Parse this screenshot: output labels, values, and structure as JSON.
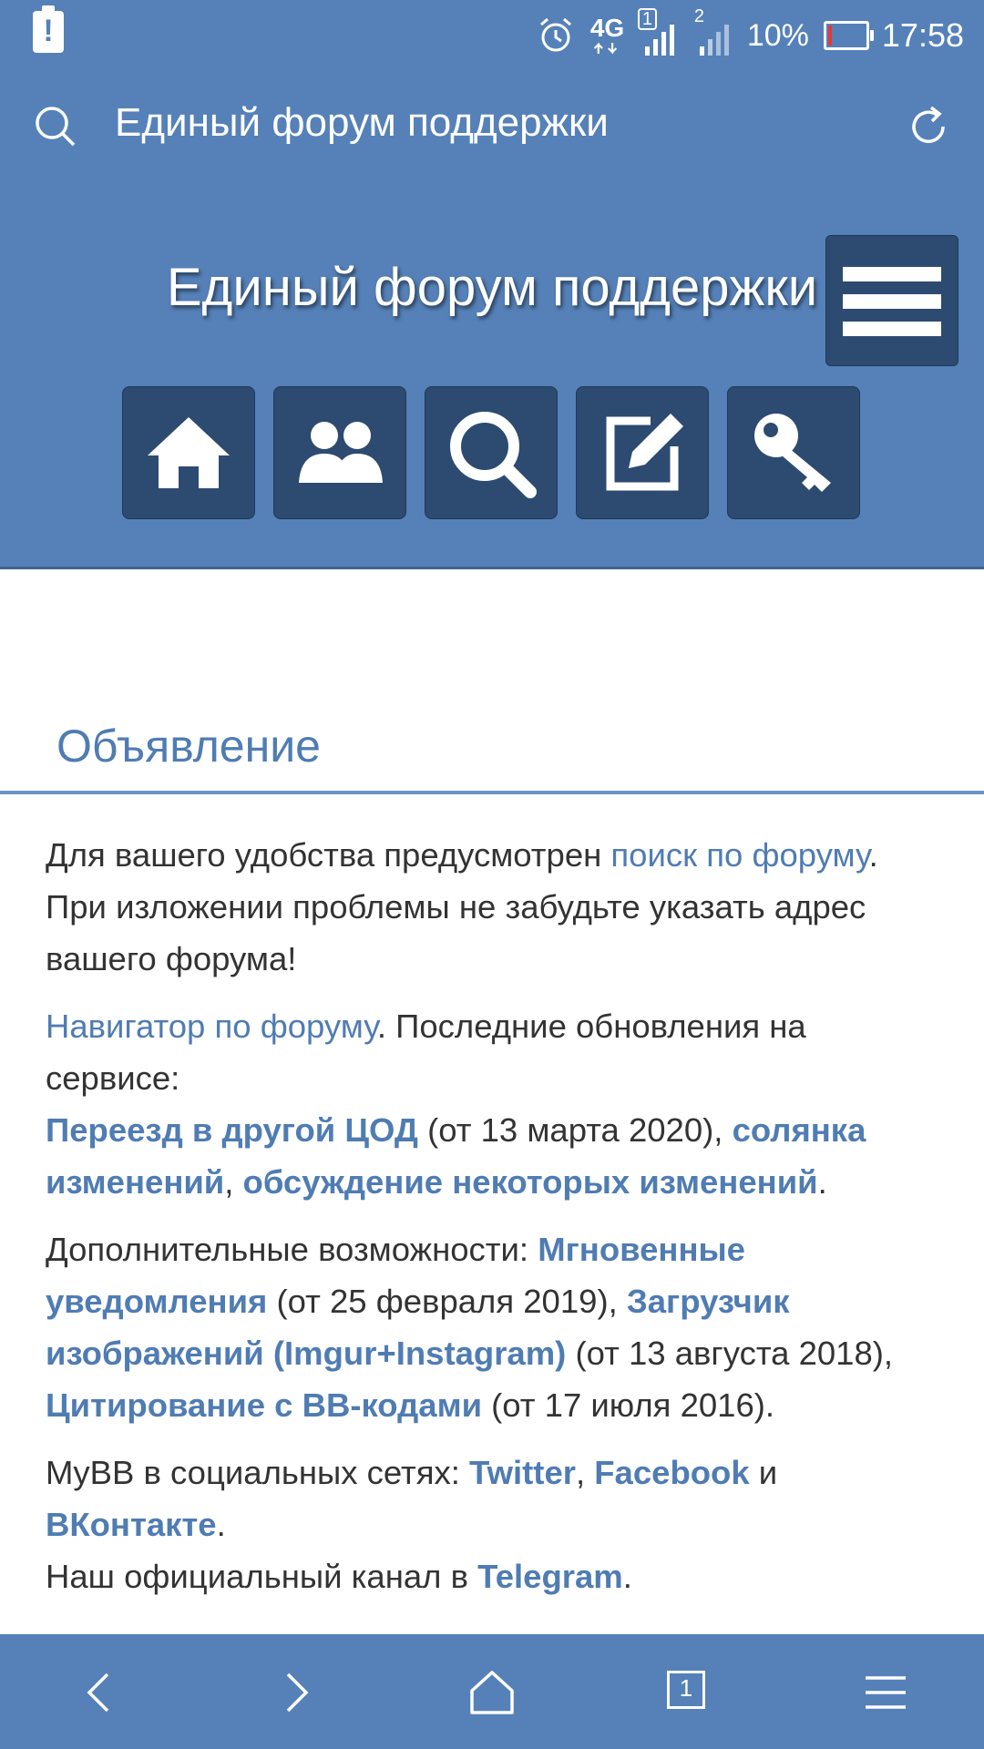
{
  "status_bar": {
    "alert_glyph": "!",
    "network_label": "4G",
    "sim1": "1",
    "sim2": "2",
    "battery_percent": "10%",
    "battery_level": 0.1,
    "time": "17:58"
  },
  "app_bar": {
    "title": "Единый форум поддержки",
    "search_icon": "search-icon",
    "reload_icon": "reload-icon"
  },
  "forum_header": {
    "title": "Единый форум поддержки",
    "nav_icons": [
      "home-icon",
      "users-icon",
      "search-icon",
      "edit-icon",
      "key-icon"
    ]
  },
  "announcement": {
    "heading": "Объявление",
    "p1": {
      "t1": "Для вашего удобства предусмотрен ",
      "link_search": "поиск по форуму",
      "t2": ". При изложении проблемы не забудьте указать адрес вашего форума!"
    },
    "p2": {
      "link_navigator": "Навигатор по форуму",
      "t1": ". Последние обновления на сервисе:",
      "link_move": "Переезд в другой ЦОД",
      "t2": " (от 13 марта 2020), ",
      "link_mix": "солянка изменений",
      "t3": ", ",
      "link_discussion": "обсуждение некоторых изменений",
      "t4": "."
    },
    "p3": {
      "t1": "Дополнительные возможности: ",
      "link_notifications": "Мгновенные уведомления",
      "t2": " (от 25 февраля 2019), ",
      "link_uploader": "Загрузчик изображений (Imgur+Instagram)",
      "t3": " (от 13 августа 2018), ",
      "link_quoting": "Цитирование с BB-кодами",
      "t4": " (от 17 июля 2016)."
    },
    "p4": {
      "t1": "MyBB в социальных сетях: ",
      "link_twitter": "Twitter",
      "t2": ", ",
      "link_facebook": "Facebook",
      "t3": " и ",
      "link_vk": "ВКонтакте",
      "t4": ".",
      "t5": "Наш официальный канал в ",
      "link_telegram": "Telegram",
      "t6": "."
    }
  },
  "bottom_nav": {
    "tabs_count": "1",
    "icons": [
      "back-icon",
      "forward-icon",
      "home-icon",
      "tabs-icon",
      "menu-icon"
    ]
  },
  "colors": {
    "header_bg": "#5581b8",
    "button_bg": "#2d4b70",
    "link": "#4f7cb3",
    "text": "#333333"
  }
}
